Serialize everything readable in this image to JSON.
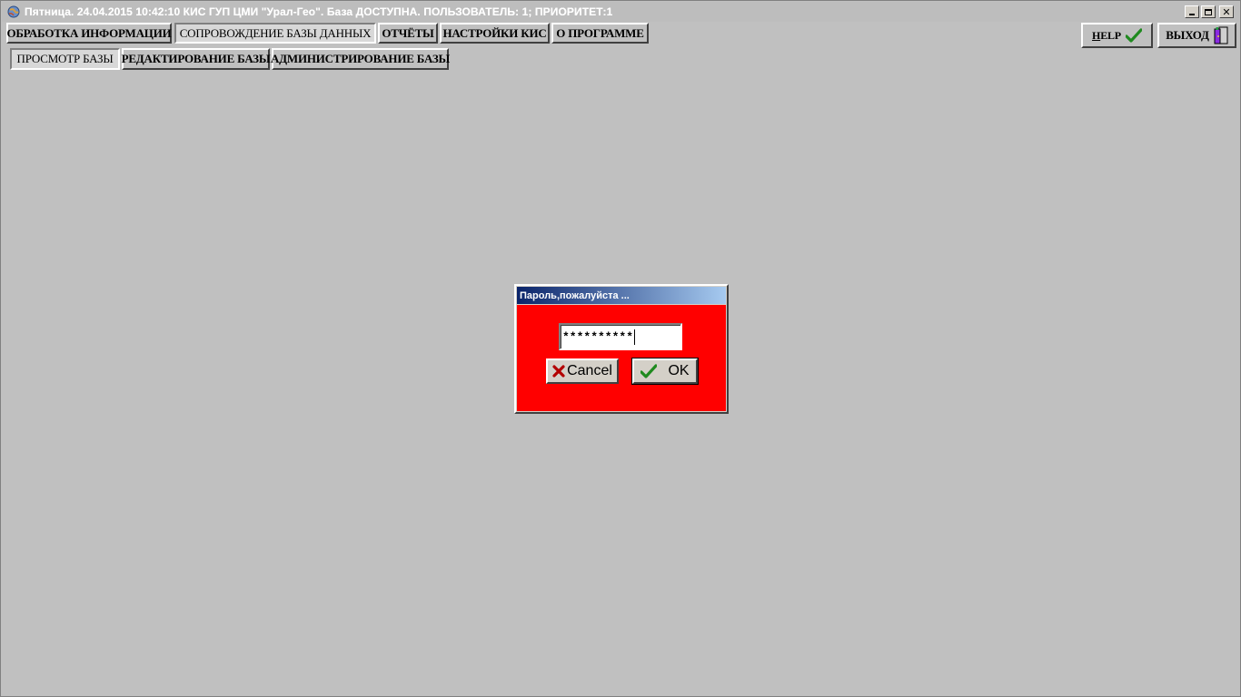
{
  "window": {
    "title": "Пятница. 24.04.2015 10:42:10 КИС ГУП ЦМИ \"Урал-Гео\". База ДОСТУПНА. ПОЛЬЗОВАТЕЛЬ: 1; ПРИОРИТЕТ:1",
    "controls": {
      "minimize": "minimize-icon",
      "maximize": "maximize-icon",
      "close": "close-icon"
    }
  },
  "main_tabs": [
    {
      "label": "ОБРАБОТКА ИНФОРМАЦИИ",
      "active": false
    },
    {
      "label": "СОПРОВОЖДЕНИЕ БАЗЫ ДАННЫХ",
      "active": true
    },
    {
      "label": "ОТЧЁТЫ",
      "active": false
    },
    {
      "label": "НАСТРОЙКИ КИС",
      "active": false
    },
    {
      "label": "О ПРОГРАММЕ",
      "active": false
    }
  ],
  "sub_tabs": [
    {
      "label": "ПРОСМОТР БАЗЫ",
      "active": true
    },
    {
      "label": "РЕДАКТИРОВАНИЕ БАЗЫ",
      "active": false
    },
    {
      "label": "АДМИНИСТРИРОВАНИЕ БАЗЫ",
      "active": false
    }
  ],
  "toolbar": {
    "help_label": "HELP",
    "help_icon": "checkmark-icon",
    "exit_label": "ВЫХОД",
    "exit_icon": "door-exit-icon"
  },
  "dialog": {
    "title": "Пароль,пожалуйста ...",
    "password_value": "**********",
    "cancel_label": "Cancel",
    "cancel_icon": "x-mark-icon",
    "ok_label": "OK",
    "ok_icon": "checkmark-icon"
  },
  "colors": {
    "workspace": "#c0c0c0",
    "dialog_body": "#ff0000",
    "dialog_title_start": "#0a246a",
    "dialog_title_end": "#a6caf0",
    "check_green": "#1f8a1f",
    "cancel_red": "#b30000"
  }
}
